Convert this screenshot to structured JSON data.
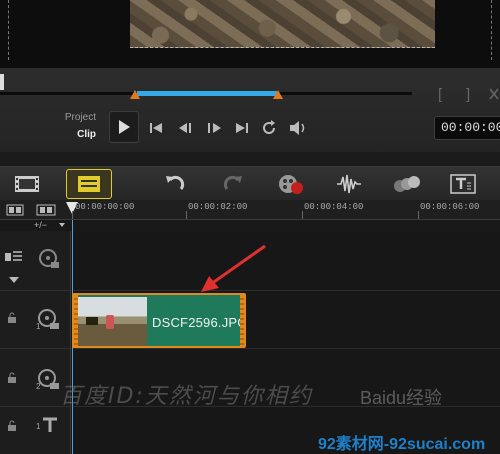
{
  "transport": {
    "mode_project": "Project",
    "mode_clip": "Clip",
    "timecode": "00:00:00",
    "bracket_in": "[",
    "bracket_out": "]"
  },
  "toolbar": {
    "items": [
      "storyboard-view",
      "timeline-view",
      "undo",
      "redo",
      "record-capture",
      "sound-mixer",
      "auto-music",
      "title"
    ]
  },
  "ruler": {
    "ticks": [
      "00:00:00:00",
      "00:00:02:00",
      "00:00:04:00",
      "00:00:06:00"
    ]
  },
  "tracks": {
    "add_remove": "+/−",
    "video_track_label": "1",
    "overlay_track_label": "2",
    "title_track_label": "1"
  },
  "clip": {
    "name": "DSCF2596.JPG",
    "colors": {
      "fill": "#1f7a5c",
      "border": "#e08a1e"
    }
  },
  "watermark": {
    "text": "百度ID:天然河与你相约",
    "brand": "Baidu经验",
    "site": "92素材网-92sucai.com"
  },
  "colors": {
    "accent_selection": "#35a9e8",
    "active_tool": "#e2cc2c",
    "marker": "#e07a1e"
  }
}
